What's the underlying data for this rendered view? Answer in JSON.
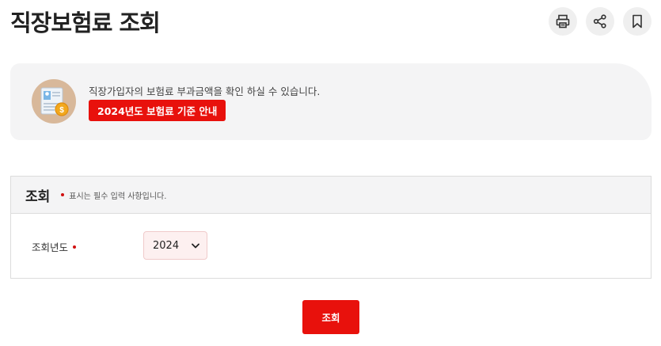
{
  "header": {
    "title": "직장보험료 조회",
    "tools": [
      {
        "icon": "printer-icon",
        "action": "print"
      },
      {
        "icon": "share-icon",
        "action": "share"
      },
      {
        "icon": "bookmark-icon",
        "action": "bookmark"
      }
    ]
  },
  "info": {
    "description": "직장가입자의 보험료 부과금액을 확인 하실 수 있습니다.",
    "guide_link_label": "2024년도 보험료 기준 안내",
    "illustration_icon": "id-card-coin-icon"
  },
  "form": {
    "title": "조회",
    "required_note": "표시는 필수 입력 사항입니다.",
    "fields": {
      "year": {
        "label": "조회년도",
        "selected": "2024",
        "required": true
      }
    }
  },
  "actions": {
    "search_label": "조회"
  },
  "colors": {
    "accent": "#e8110c",
    "panel_bg": "#f4f4f5",
    "required_dot": "#d01010",
    "illustration_bg": "#d8b89a"
  }
}
